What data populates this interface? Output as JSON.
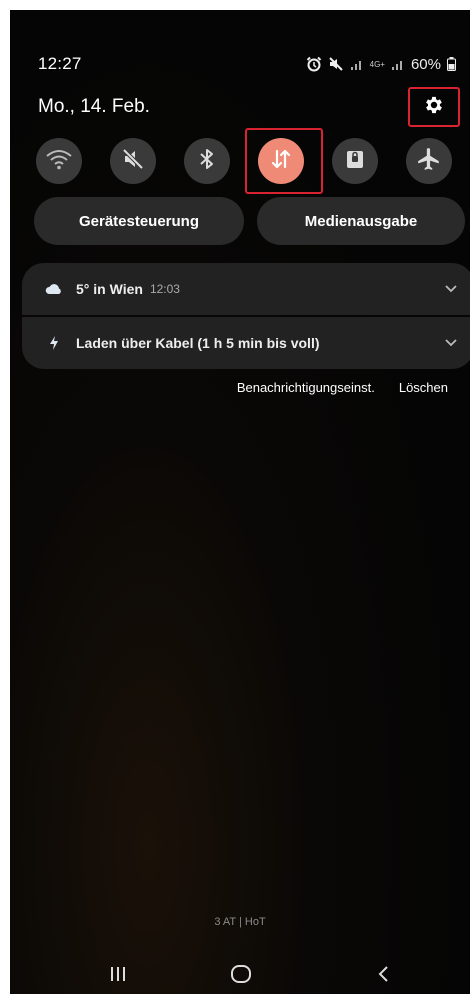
{
  "status_bar": {
    "time": "12:27",
    "network": "4G+",
    "battery": "60%"
  },
  "header": {
    "date": "Mo., 14. Feb.",
    "settings_icon": "gear-icon"
  },
  "quick_toggles": [
    {
      "name": "wifi",
      "icon": "wifi-icon",
      "active": false
    },
    {
      "name": "sound",
      "icon": "mute-icon",
      "active": false
    },
    {
      "name": "bluetooth",
      "icon": "bluetooth-icon",
      "active": false
    },
    {
      "name": "mobile-data",
      "icon": "data-arrows-icon",
      "active": true
    },
    {
      "name": "lock",
      "icon": "lock-screen-icon",
      "active": false
    },
    {
      "name": "airplane",
      "icon": "airplane-icon",
      "active": false
    }
  ],
  "pills": {
    "device_control": "Gerätesteuerung",
    "media_output": "Medienausgabe"
  },
  "notifications": {
    "weather": {
      "title": "5° in Wien",
      "time": "12:03",
      "icon": "cloud-icon"
    },
    "charging": {
      "title": "Laden über Kabel (1 h 5 min bis voll)",
      "icon": "bolt-icon"
    }
  },
  "actions": {
    "settings": "Benachrichtigungseinst.",
    "clear": "Löschen"
  },
  "carrier": "3 AT | HoT",
  "colors": {
    "active_toggle": "#ee8a76",
    "highlight": "#d92330",
    "tile": "#3a3a3a",
    "card": "#222222"
  }
}
